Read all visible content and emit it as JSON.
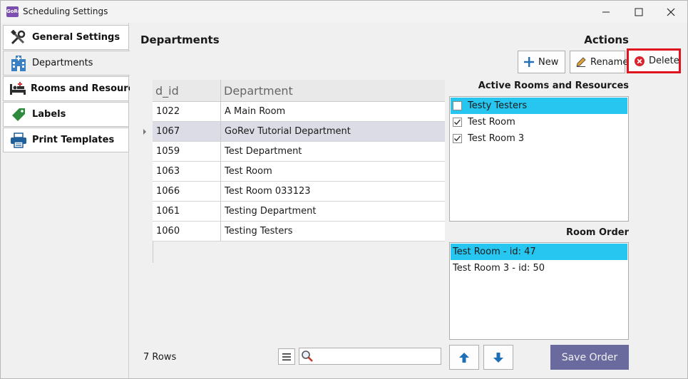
{
  "window": {
    "title": "Scheduling Settings",
    "app_icon_text": "GoRev"
  },
  "sidebar": {
    "items": [
      {
        "label": "General Settings",
        "icon": "tools-icon"
      },
      {
        "label": "Departments",
        "icon": "hospital-icon"
      },
      {
        "label": "Rooms and Resources",
        "icon": "bed-icon"
      },
      {
        "label": "Labels",
        "icon": "tag-icon"
      },
      {
        "label": "Print Templates",
        "icon": "printer-icon"
      }
    ],
    "active_index": 1
  },
  "main": {
    "title": "Departments",
    "actions_title": "Actions",
    "buttons": {
      "new": "New",
      "rename": "Rename",
      "delete": "Delete"
    },
    "grid": {
      "columns": [
        "d_id",
        "Department"
      ],
      "rows": [
        {
          "id": "1022",
          "name": "A Main Room"
        },
        {
          "id": "1067",
          "name": "GoRev Tutorial Department"
        },
        {
          "id": "1059",
          "name": "Test Department"
        },
        {
          "id": "1063",
          "name": "Test Room"
        },
        {
          "id": "1066",
          "name": "Test Room 033123"
        },
        {
          "id": "1061",
          "name": "Testing Department"
        },
        {
          "id": "1060",
          "name": "Testing Testers"
        }
      ],
      "selected_index": 1
    },
    "row_count": "7 Rows",
    "search": {
      "value": "",
      "placeholder": ""
    }
  },
  "active_rooms": {
    "title": "Active Rooms and Resources",
    "items": [
      {
        "label": "Testy Testers",
        "checked": false,
        "highlighted": true
      },
      {
        "label": "Test Room",
        "checked": true,
        "highlighted": false
      },
      {
        "label": "Test Room 3",
        "checked": true,
        "highlighted": false
      }
    ]
  },
  "room_order": {
    "title": "Room Order",
    "items": [
      {
        "label": "Test Room - id: 47",
        "highlighted": true
      },
      {
        "label": "Test Room 3 - id: 50",
        "highlighted": false
      }
    ],
    "save_label": "Save Order"
  },
  "colors": {
    "highlight": "#26c6f0",
    "selected_row": "#dcdce6",
    "delete_frame": "#e0141e",
    "save_button": "#6a6a9e",
    "arrow": "#1e6fb8"
  }
}
